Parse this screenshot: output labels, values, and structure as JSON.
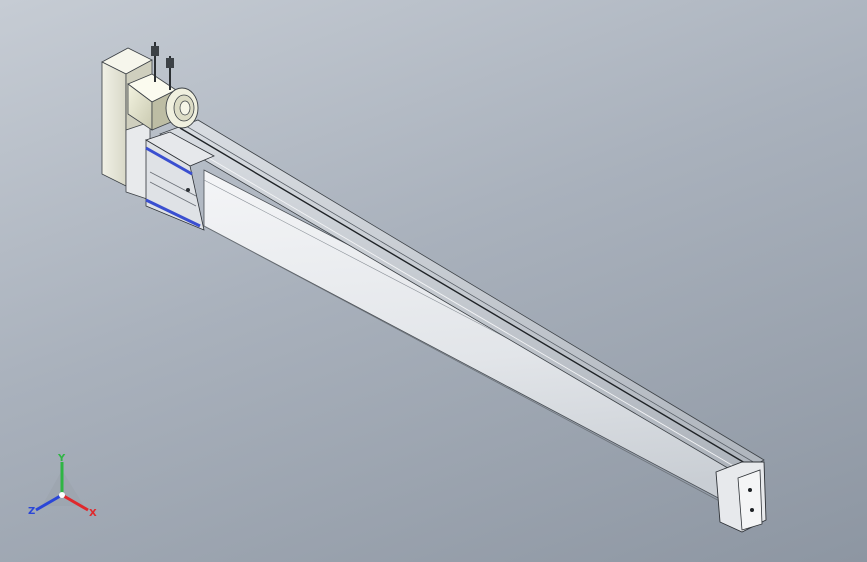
{
  "triad": {
    "x_label": "X",
    "y_label": "Y",
    "z_label": "Z",
    "x_color": "#e0282c",
    "y_color": "#2fb544",
    "z_color": "#2a46d8"
  },
  "colors": {
    "background_top": "#c6ccd4",
    "background_bottom": "#8d96a2",
    "carriage_accent": "#3a4fd0",
    "rail_body": "#e6e9ec",
    "motor_body": "#e9ead4"
  },
  "icons": [
    "coordinate-triad-icon"
  ]
}
